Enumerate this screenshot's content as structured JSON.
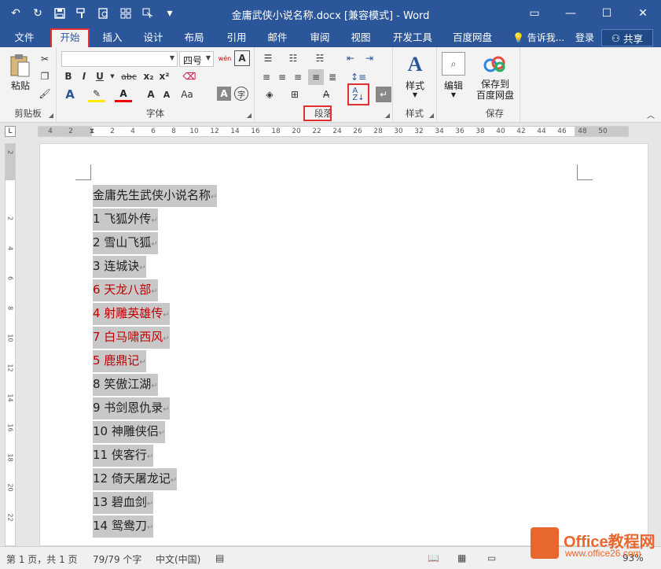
{
  "window": {
    "title": "金庸武侠小说名称.docx [兼容模式] - Word",
    "min": "—",
    "restore": "☐",
    "close": "✕",
    "ribbon_toggle": "▭"
  },
  "qat": {
    "undo": "↶",
    "redo": "↻",
    "save": "💾",
    "more": "▾"
  },
  "tabs": [
    {
      "label": "文件"
    },
    {
      "label": "开始"
    },
    {
      "label": "插入"
    },
    {
      "label": "设计"
    },
    {
      "label": "布局"
    },
    {
      "label": "引用"
    },
    {
      "label": "邮件"
    },
    {
      "label": "审阅"
    },
    {
      "label": "视图"
    },
    {
      "label": "开发工具"
    },
    {
      "label": "百度网盘"
    }
  ],
  "tell_me": "告诉我...",
  "login": "登录",
  "share": "共享",
  "ribbon": {
    "clipboard": {
      "label": "剪贴板",
      "paste": "粘贴"
    },
    "font": {
      "label": "字体",
      "font_name": "",
      "font_size": "四号",
      "bold": "B",
      "italic": "I",
      "underline": "U",
      "strike": "abc",
      "sub": "x₂",
      "sup": "x²",
      "wen": "wén",
      "grow": "A",
      "shrink": "A",
      "aa": "Aa",
      "char_border": "A",
      "char_shade": "A",
      "enclose": "字"
    },
    "paragraph": {
      "label": "段落"
    },
    "styles": {
      "label": "样式",
      "btn": "样式"
    },
    "editing": {
      "btn": "编辑"
    },
    "save": {
      "label": "保存",
      "btn_line1": "保存到",
      "btn_line2": "百度网盘"
    }
  },
  "ruler": {
    "ticks": [
      "4",
      "2",
      "",
      "2",
      "4",
      "6",
      "8",
      "10",
      "12",
      "14",
      "16",
      "18",
      "20",
      "22",
      "24",
      "26",
      "28",
      "30",
      "32",
      "34",
      "36",
      "38",
      "40",
      "42",
      "44",
      "46",
      "48",
      "50"
    ],
    "tab_selector": "L",
    "v_ticks": [
      "2",
      "",
      "2",
      "4",
      "6",
      "8",
      "10",
      "12",
      "14",
      "16",
      "18",
      "20",
      "22"
    ]
  },
  "document": {
    "paragraph_mark": "↵",
    "lines": [
      {
        "text": "金庸先生武侠小说名称",
        "red": false
      },
      {
        "text": "1 飞狐外传",
        "red": false
      },
      {
        "text": "2 雪山飞狐",
        "red": false
      },
      {
        "text": "3 连城诀",
        "red": false
      },
      {
        "text": "6 天龙八部",
        "red": true
      },
      {
        "text": "4 射雕英雄传",
        "red": true
      },
      {
        "text": "7 白马啸西风",
        "red": true
      },
      {
        "text": "5 鹿鼎记",
        "red": true
      },
      {
        "text": "8 笑傲江湖",
        "red": false
      },
      {
        "text": "9 书剑恩仇录",
        "red": false
      },
      {
        "text": "10 神雕侠侣",
        "red": false
      },
      {
        "text": "11 侠客行",
        "red": false
      },
      {
        "text": "12 倚天屠龙记",
        "red": false
      },
      {
        "text": "13 碧血剑",
        "red": false
      },
      {
        "text": "14 鸳鸯刀",
        "red": false
      }
    ]
  },
  "status": {
    "page": "第 1 页，共 1 页",
    "words": "79/79 个字",
    "language": "中文(中国)",
    "zoom": "93%"
  },
  "watermark": {
    "title": "Office教程网",
    "url": "www.office26.com"
  },
  "colors": {
    "title_bg": "#2b579a",
    "highlight": "#c8c8c8",
    "red_text": "#c00000",
    "annotation_box": "#e03030"
  }
}
